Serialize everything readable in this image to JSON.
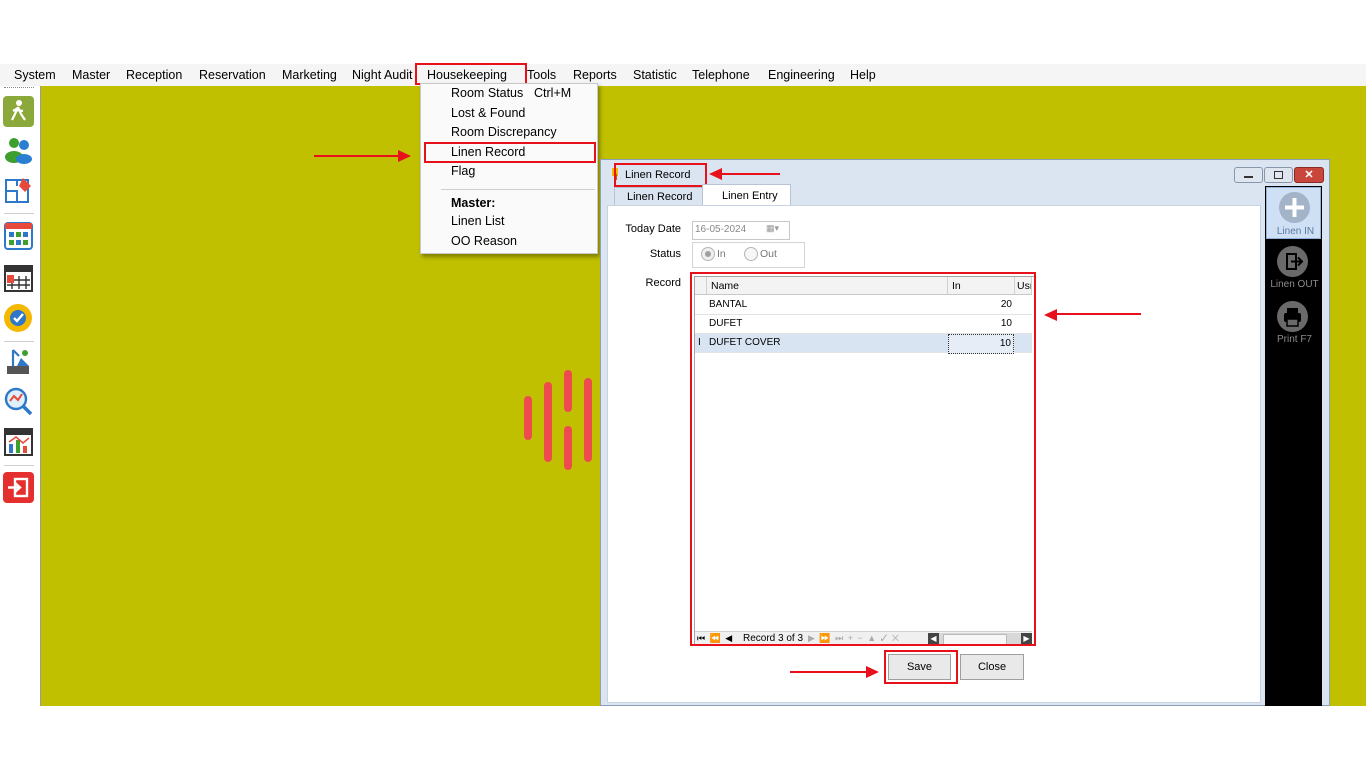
{
  "menu": [
    "System",
    "Master",
    "Reception",
    "Reservation",
    "Marketing",
    "Night Audit",
    "Housekeeping",
    "Tools",
    "Reports",
    "Statistic",
    "Telephone",
    "Engineering",
    "Help"
  ],
  "dropdown": {
    "items": [
      {
        "label": "Room Status",
        "shortcut": "Ctrl+M"
      },
      {
        "label": "Lost & Found"
      },
      {
        "label": "Room Discrepancy"
      },
      {
        "label": "Linen Record"
      },
      {
        "label": "Flag"
      }
    ],
    "section_title": "Master:",
    "section_items": [
      "Linen List",
      "OO Reason"
    ]
  },
  "window": {
    "title": "Linen Record",
    "tabs": [
      "Linen Record",
      "Linen Entry"
    ],
    "active_tab": "Linen Entry",
    "today_date_label": "Today Date",
    "today_date_value": "16-05-2024",
    "status_label": "Status",
    "status_options": [
      "In",
      "Out"
    ],
    "record_label": "Record",
    "grid": {
      "columns": [
        "Name",
        "In",
        "Usr"
      ],
      "rows": [
        {
          "name": "BANTAL",
          "in": "20"
        },
        {
          "name": "DUFET",
          "in": "10"
        },
        {
          "name": "DUFET COVER",
          "in": "10"
        }
      ],
      "row_cursor": "I",
      "navigator_text": "Record 3 of 3"
    },
    "save_label": "Save",
    "close_label": "Close"
  },
  "side_actions": [
    "Linen IN",
    "Linen OUT",
    "Print F7"
  ],
  "colors": {
    "desktop": "#c0c000",
    "annotation": "#e8101a"
  }
}
